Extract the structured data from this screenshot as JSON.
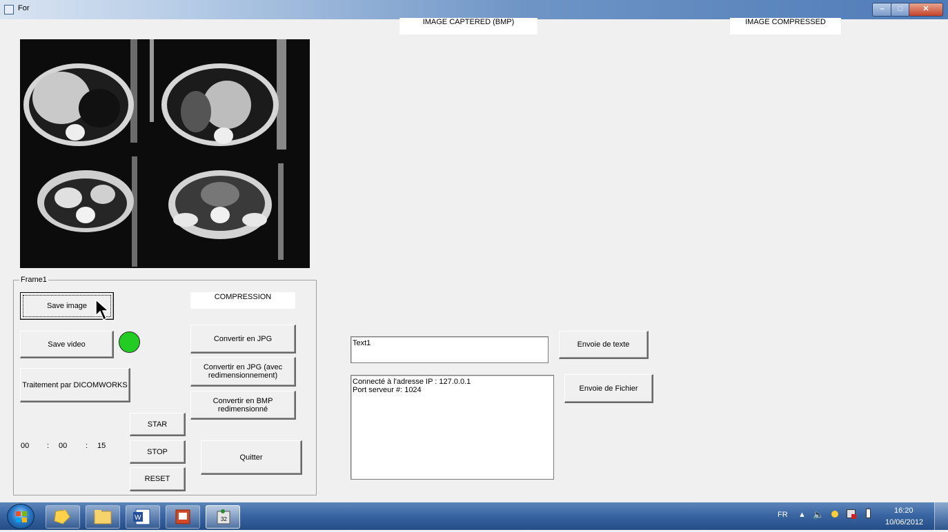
{
  "window": {
    "title": "For"
  },
  "labels": {
    "image_captured": "IMAGE CAPTERED (BMP)",
    "image_compressed": "IMAGE COMPRESSED",
    "compression": "COMPRESSION",
    "frame": "Frame1"
  },
  "buttons": {
    "save_image": "Save image",
    "save_video": "Save video",
    "dicomworks": "Traitement par DICOMWORKS",
    "convert_jpg": "Convertir en JPG",
    "convert_jpg_resize": "Convertir en JPG (avec redimensionnement)",
    "convert_bmp_resize": "Convertir en BMP redimensionné",
    "star": "STAR",
    "stop": "STOP",
    "reset": "RESET",
    "quit": "Quitter",
    "send_text": "Envoie de texte",
    "send_file": "Envoie de Fichier"
  },
  "timer": {
    "hours": "00",
    "sep1": ":",
    "minutes": "00",
    "sep2": ":",
    "seconds": "15"
  },
  "text_input": {
    "value": "Text1"
  },
  "log": {
    "line1": "Connecté à l'adresse IP : 127.0.0.1",
    "line2": "Port serveur #: 1024"
  },
  "status_indicator": {
    "color": "#22cc22"
  },
  "taskbar": {
    "language": "FR",
    "time": "16:20",
    "date": "10/06/2012"
  }
}
